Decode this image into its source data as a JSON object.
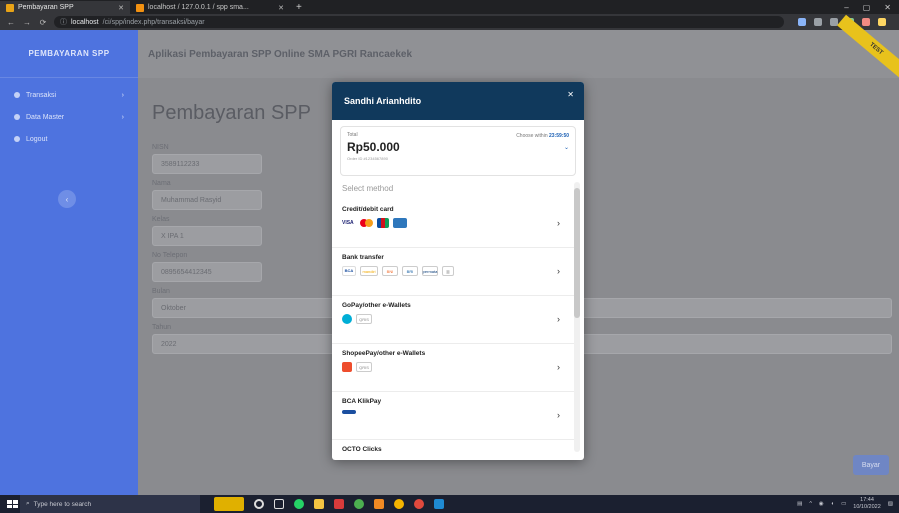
{
  "browser": {
    "tabs": [
      {
        "title": "Pembayaran SPP",
        "active": true,
        "favicon_color": "#e8a317"
      },
      {
        "title": "localhost / 127.0.0.1 / spp sma...",
        "active": false,
        "favicon_color": "#f29111"
      }
    ],
    "new_tab": "+",
    "window_controls": [
      "–",
      "▢",
      "✕"
    ],
    "url_host": "localhost",
    "url_path": "/ci/spp/index.php/transaksi/bayar",
    "nav": [
      "←",
      "→",
      "⟳"
    ]
  },
  "sidebar": {
    "brand": "PEMBAYARAN SPP",
    "items": [
      {
        "label": "Transaksi",
        "has_chevron": true
      },
      {
        "label": "Data Master",
        "has_chevron": true
      },
      {
        "label": "Logout",
        "has_chevron": false
      }
    ],
    "toggle": "‹"
  },
  "topbar": {
    "title": "Aplikasi Pembayaran SPP Online SMA PGRI Rancaekek",
    "ribbon": "TEST"
  },
  "page": {
    "title": "Pembayaran SPP",
    "fields": [
      {
        "label": "NISN",
        "value": "3589112233",
        "wide": false
      },
      {
        "label": "Nama",
        "value": "Muhammad Rasyid",
        "wide": false
      },
      {
        "label": "Kelas",
        "value": "X IPA 1",
        "wide": false
      },
      {
        "label": "No Telepon",
        "value": "0895654412345",
        "wide": false
      },
      {
        "label": "Bulan",
        "value": "Oktober",
        "wide": true
      },
      {
        "label": "Tahun",
        "value": "2022",
        "wide": true
      }
    ],
    "submit": "Bayar"
  },
  "modal": {
    "name": "Sandhi Arianhdito",
    "close": "✕",
    "total_label": "Total",
    "amount": "Rp50.000",
    "order_id": "Order ID #1234567890",
    "expiry_prefix": "Choose within",
    "expiry_time": "23:59:50",
    "select_method": "Select method",
    "methods": [
      {
        "name": "Credit/debit card",
        "logos": [
          "VISA",
          "MC",
          "JCB",
          "AMEX"
        ]
      },
      {
        "name": "Bank transfer",
        "logos": [
          "BCA",
          "mandiri",
          "BNI",
          "BRI",
          "permata",
          "other"
        ]
      },
      {
        "name": "GoPay/other e-Wallets",
        "logos": [
          "gopay",
          "QRIS"
        ]
      },
      {
        "name": "ShopeePay/other e-Wallets",
        "logos": [
          "shopee",
          "QRIS"
        ]
      },
      {
        "name": "BCA KlikPay",
        "logos": [
          "klikpay"
        ]
      },
      {
        "name": "OCTO Clicks",
        "logos": []
      }
    ]
  },
  "taskbar": {
    "search_placeholder": "Type here to search",
    "time": "17:44",
    "date": "10/10/2022"
  },
  "colors": {
    "sidebar": "#4e73df",
    "modal_header": "#10395c",
    "ribbon": "#e8c21c"
  }
}
